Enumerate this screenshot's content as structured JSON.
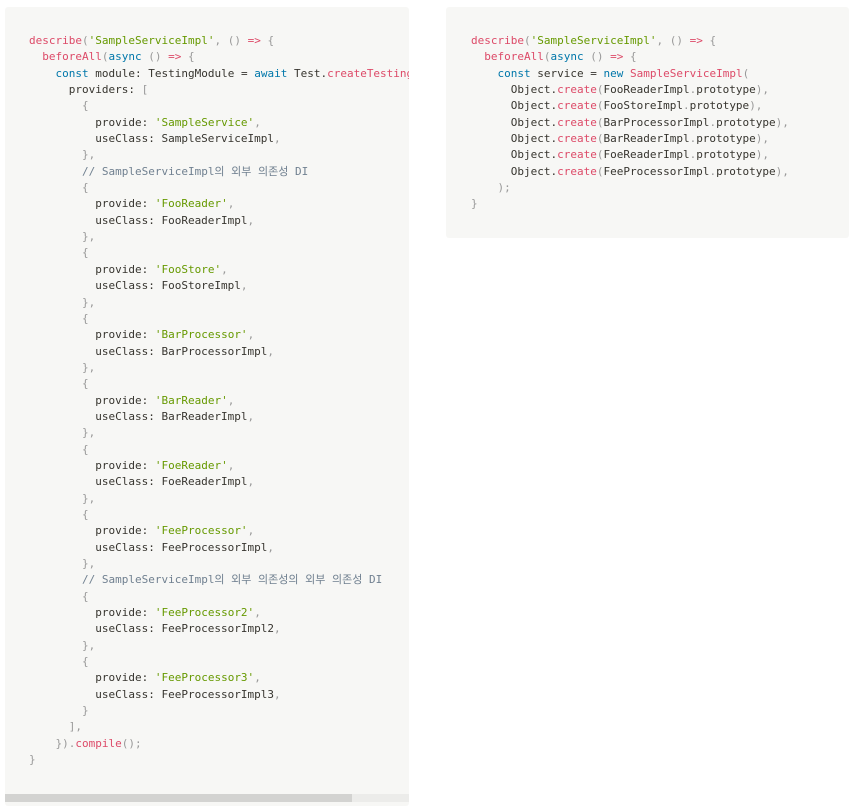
{
  "colors": {
    "background": "#f7f7f5",
    "keyword": "#0077aa",
    "function": "#dd4a68",
    "string": "#669900",
    "punctuation": "#999999",
    "comment": "#708090",
    "text": "#37352f"
  },
  "left_code": [
    [
      [
        "fn",
        "describe"
      ],
      [
        "punc",
        "("
      ],
      [
        "str",
        "'SampleServiceImpl'"
      ],
      [
        "punc",
        ", () "
      ],
      [
        "fn",
        "=>"
      ],
      [
        "punc",
        " {"
      ]
    ],
    [
      [
        "text",
        "  "
      ],
      [
        "fn",
        "beforeAll"
      ],
      [
        "punc",
        "("
      ],
      [
        "kw",
        "async"
      ],
      [
        "punc",
        " () "
      ],
      [
        "fn",
        "=>"
      ],
      [
        "punc",
        " {"
      ]
    ],
    [
      [
        "text",
        "    "
      ],
      [
        "kw",
        "const"
      ],
      [
        "text",
        " module: TestingModule = "
      ],
      [
        "kw",
        "await"
      ],
      [
        "text",
        " Test."
      ],
      [
        "fn",
        "createTestingModule"
      ],
      [
        "punc",
        "({"
      ]
    ],
    [
      [
        "text",
        "      providers: "
      ],
      [
        "punc",
        "["
      ]
    ],
    [
      [
        "text",
        "        "
      ],
      [
        "punc",
        "{"
      ]
    ],
    [
      [
        "text",
        "          provide: "
      ],
      [
        "str",
        "'SampleService'"
      ],
      [
        "punc",
        ","
      ]
    ],
    [
      [
        "text",
        "          useClass: SampleServiceImpl"
      ],
      [
        "punc",
        ","
      ]
    ],
    [
      [
        "text",
        "        "
      ],
      [
        "punc",
        "},"
      ]
    ],
    [
      [
        "text",
        "        "
      ],
      [
        "cm",
        "// SampleServiceImpl의 외부 의존성 DI"
      ]
    ],
    [
      [
        "text",
        "        "
      ],
      [
        "punc",
        "{"
      ]
    ],
    [
      [
        "text",
        "          provide: "
      ],
      [
        "str",
        "'FooReader'"
      ],
      [
        "punc",
        ","
      ]
    ],
    [
      [
        "text",
        "          useClass: FooReaderImpl"
      ],
      [
        "punc",
        ","
      ]
    ],
    [
      [
        "text",
        "        "
      ],
      [
        "punc",
        "},"
      ]
    ],
    [
      [
        "text",
        "        "
      ],
      [
        "punc",
        "{"
      ]
    ],
    [
      [
        "text",
        "          provide: "
      ],
      [
        "str",
        "'FooStore'"
      ],
      [
        "punc",
        ","
      ]
    ],
    [
      [
        "text",
        "          useClass: FooStoreImpl"
      ],
      [
        "punc",
        ","
      ]
    ],
    [
      [
        "text",
        "        "
      ],
      [
        "punc",
        "},"
      ]
    ],
    [
      [
        "text",
        "        "
      ],
      [
        "punc",
        "{"
      ]
    ],
    [
      [
        "text",
        "          provide: "
      ],
      [
        "str",
        "'BarProcessor'"
      ],
      [
        "punc",
        ","
      ]
    ],
    [
      [
        "text",
        "          useClass: BarProcessorImpl"
      ],
      [
        "punc",
        ","
      ]
    ],
    [
      [
        "text",
        "        "
      ],
      [
        "punc",
        "},"
      ]
    ],
    [
      [
        "text",
        "        "
      ],
      [
        "punc",
        "{"
      ]
    ],
    [
      [
        "text",
        "          provide: "
      ],
      [
        "str",
        "'BarReader'"
      ],
      [
        "punc",
        ","
      ]
    ],
    [
      [
        "text",
        "          useClass: BarReaderImpl"
      ],
      [
        "punc",
        ","
      ]
    ],
    [
      [
        "text",
        "        "
      ],
      [
        "punc",
        "},"
      ]
    ],
    [
      [
        "text",
        "        "
      ],
      [
        "punc",
        "{"
      ]
    ],
    [
      [
        "text",
        "          provide: "
      ],
      [
        "str",
        "'FoeReader'"
      ],
      [
        "punc",
        ","
      ]
    ],
    [
      [
        "text",
        "          useClass: FoeReaderImpl"
      ],
      [
        "punc",
        ","
      ]
    ],
    [
      [
        "text",
        "        "
      ],
      [
        "punc",
        "},"
      ]
    ],
    [
      [
        "text",
        "        "
      ],
      [
        "punc",
        "{"
      ]
    ],
    [
      [
        "text",
        "          provide: "
      ],
      [
        "str",
        "'FeeProcessor'"
      ],
      [
        "punc",
        ","
      ]
    ],
    [
      [
        "text",
        "          useClass: FeeProcessorImpl"
      ],
      [
        "punc",
        ","
      ]
    ],
    [
      [
        "text",
        "        "
      ],
      [
        "punc",
        "},"
      ]
    ],
    [
      [
        "text",
        "        "
      ],
      [
        "cm",
        "// SampleServiceImpl의 외부 의존성의 외부 의존성 DI"
      ]
    ],
    [
      [
        "text",
        "        "
      ],
      [
        "punc",
        "{"
      ]
    ],
    [
      [
        "text",
        "          provide: "
      ],
      [
        "str",
        "'FeeProcessor2'"
      ],
      [
        "punc",
        ","
      ]
    ],
    [
      [
        "text",
        "          useClass: FeeProcessorImpl2"
      ],
      [
        "punc",
        ","
      ]
    ],
    [
      [
        "text",
        "        "
      ],
      [
        "punc",
        "},"
      ]
    ],
    [
      [
        "text",
        "        "
      ],
      [
        "punc",
        "{"
      ]
    ],
    [
      [
        "text",
        "          provide: "
      ],
      [
        "str",
        "'FeeProcessor3'"
      ],
      [
        "punc",
        ","
      ]
    ],
    [
      [
        "text",
        "          useClass: FeeProcessorImpl3"
      ],
      [
        "punc",
        ","
      ]
    ],
    [
      [
        "text",
        "        "
      ],
      [
        "punc",
        "}"
      ]
    ],
    [
      [
        "text",
        "      "
      ],
      [
        "punc",
        "],"
      ]
    ],
    [
      [
        "text",
        "    "
      ],
      [
        "punc",
        "})."
      ],
      [
        "fn",
        "compile"
      ],
      [
        "punc",
        "();"
      ]
    ],
    [
      [
        "punc",
        "}"
      ]
    ]
  ],
  "right_code": [
    [
      [
        "fn",
        "describe"
      ],
      [
        "punc",
        "("
      ],
      [
        "str",
        "'SampleServiceImpl'"
      ],
      [
        "punc",
        ", () "
      ],
      [
        "fn",
        "=>"
      ],
      [
        "punc",
        " {"
      ]
    ],
    [
      [
        "text",
        "  "
      ],
      [
        "fn",
        "beforeAll"
      ],
      [
        "punc",
        "("
      ],
      [
        "kw",
        "async"
      ],
      [
        "punc",
        " () "
      ],
      [
        "fn",
        "=>"
      ],
      [
        "punc",
        " {"
      ]
    ],
    [
      [
        "text",
        "    "
      ],
      [
        "kw",
        "const"
      ],
      [
        "text",
        " service = "
      ],
      [
        "kw",
        "new"
      ],
      [
        "text",
        " "
      ],
      [
        "fn",
        "SampleServiceImpl"
      ],
      [
        "punc",
        "("
      ]
    ],
    [
      [
        "text",
        "      Object."
      ],
      [
        "fn",
        "create"
      ],
      [
        "punc",
        "("
      ],
      [
        "text",
        "FooReaderImpl"
      ],
      [
        "punc",
        "."
      ],
      [
        "text",
        "prototype"
      ],
      [
        "punc",
        "),"
      ]
    ],
    [
      [
        "text",
        "      Object."
      ],
      [
        "fn",
        "create"
      ],
      [
        "punc",
        "("
      ],
      [
        "text",
        "FooStoreImpl"
      ],
      [
        "punc",
        "."
      ],
      [
        "text",
        "prototype"
      ],
      [
        "punc",
        "),"
      ]
    ],
    [
      [
        "text",
        "      Object."
      ],
      [
        "fn",
        "create"
      ],
      [
        "punc",
        "("
      ],
      [
        "text",
        "BarProcessorImpl"
      ],
      [
        "punc",
        "."
      ],
      [
        "text",
        "prototype"
      ],
      [
        "punc",
        "),"
      ]
    ],
    [
      [
        "text",
        "      Object."
      ],
      [
        "fn",
        "create"
      ],
      [
        "punc",
        "("
      ],
      [
        "text",
        "BarReaderImpl"
      ],
      [
        "punc",
        "."
      ],
      [
        "text",
        "prototype"
      ],
      [
        "punc",
        "),"
      ]
    ],
    [
      [
        "text",
        "      Object."
      ],
      [
        "fn",
        "create"
      ],
      [
        "punc",
        "("
      ],
      [
        "text",
        "FoeReaderImpl"
      ],
      [
        "punc",
        "."
      ],
      [
        "text",
        "prototype"
      ],
      [
        "punc",
        "),"
      ]
    ],
    [
      [
        "text",
        "      Object."
      ],
      [
        "fn",
        "create"
      ],
      [
        "punc",
        "("
      ],
      [
        "text",
        "FeeProcessorImpl"
      ],
      [
        "punc",
        "."
      ],
      [
        "text",
        "prototype"
      ],
      [
        "punc",
        "),"
      ]
    ],
    [
      [
        "text",
        "    "
      ],
      [
        "punc",
        ");"
      ]
    ],
    [
      [
        "punc",
        "}"
      ]
    ]
  ],
  "left_scroll": {
    "visible_fraction": 0.86
  }
}
